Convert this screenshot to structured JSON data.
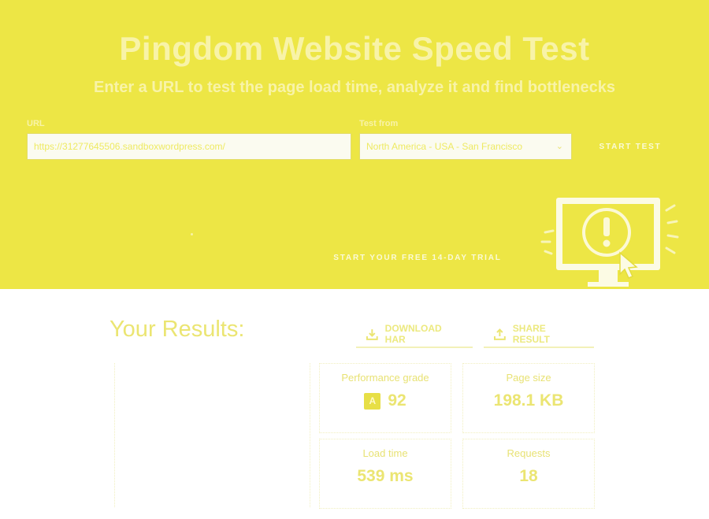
{
  "hero": {
    "title": "Pingdom Website Speed Test",
    "subtitle": "Enter a URL to test the page load time, analyze it and find bottlenecks",
    "url_label": "URL",
    "url_value": "https://31277645506.sandboxwordpress.com/",
    "location_label": "Test from",
    "location_value": "North America - USA - San Francisco",
    "start_test_label": "START TEST",
    "trial_label": "START YOUR FREE 14-DAY TRIAL"
  },
  "colors": {
    "hero_bg": "#ede645",
    "accent": "#ebe572",
    "white": "#ffffff"
  },
  "results": {
    "title": "Your Results:",
    "download_label": "DOWNLOAD HAR",
    "share_label": "SHARE RESULT",
    "metrics": [
      {
        "label": "Performance grade",
        "grade": "A",
        "value": "92"
      },
      {
        "label": "Page size",
        "value": "198.1 KB"
      },
      {
        "label": "Load time",
        "value": "539 ms"
      },
      {
        "label": "Requests",
        "value": "18"
      }
    ]
  },
  "icons": {
    "download": "download-icon",
    "share": "share-icon",
    "dropdown": "chevron-down-icon",
    "alert": "alert-monitor-icon"
  }
}
